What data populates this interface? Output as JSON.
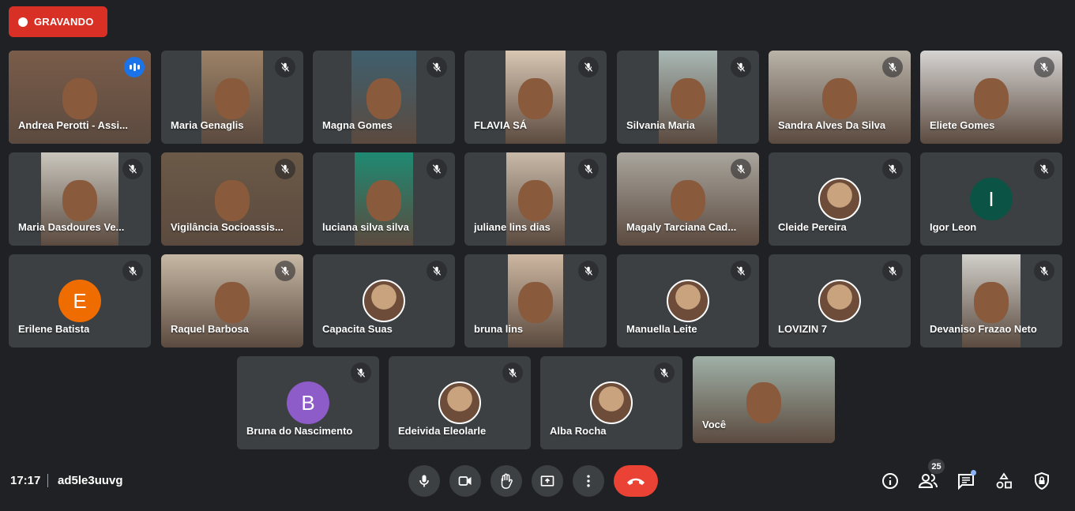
{
  "recording": {
    "label": "GRAVANDO"
  },
  "meeting": {
    "time": "17:17",
    "code": "ad5le3uuvg"
  },
  "participant_count": "25",
  "colors": {
    "background": "#202124",
    "tile": "#3c4043",
    "recording": "#d93025",
    "hangup": "#ea4335",
    "active_speaker": "#1a73e8"
  },
  "participants": [
    {
      "name": "Andrea Perotti - Assi...",
      "status": "speaking",
      "kind": "video"
    },
    {
      "name": "Maria Genaglis",
      "status": "muted",
      "kind": "video"
    },
    {
      "name": "Magna Gomes",
      "status": "muted",
      "kind": "video"
    },
    {
      "name": "FLAVIA SÁ",
      "status": "muted",
      "kind": "video"
    },
    {
      "name": "Silvania Maria",
      "status": "muted",
      "kind": "video"
    },
    {
      "name": "Sandra Alves Da Silva",
      "status": "muted",
      "kind": "video"
    },
    {
      "name": "Eliete Gomes",
      "status": "muted",
      "kind": "video"
    },
    {
      "name": "Maria Dasdoures Ve...",
      "status": "muted",
      "kind": "video"
    },
    {
      "name": "Vigilância Socioassis...",
      "status": "muted",
      "kind": "video"
    },
    {
      "name": "luciana silva silva",
      "status": "muted",
      "kind": "video"
    },
    {
      "name": "juliane lins dias",
      "status": "muted",
      "kind": "video"
    },
    {
      "name": "Magaly Tarciana Cad...",
      "status": "muted",
      "kind": "video"
    },
    {
      "name": "Cleide Pereira",
      "status": "muted",
      "kind": "photo-avatar"
    },
    {
      "name": "Igor Leon",
      "status": "muted",
      "kind": "letter-avatar",
      "initial": "I",
      "avatar_color": "#0b5345"
    },
    {
      "name": "Erilene Batista",
      "status": "muted",
      "kind": "letter-avatar",
      "initial": "E",
      "avatar_color": "#ef6c00"
    },
    {
      "name": "Raquel Barbosa",
      "status": "muted",
      "kind": "video"
    },
    {
      "name": "Capacita Suas",
      "status": "muted",
      "kind": "photo-avatar"
    },
    {
      "name": "bruna lins",
      "status": "muted",
      "kind": "video"
    },
    {
      "name": "Manuella Leite",
      "status": "muted",
      "kind": "photo-avatar"
    },
    {
      "name": "LOVIZIN 7",
      "status": "muted",
      "kind": "photo-avatar"
    },
    {
      "name": "Devaniso Frazao Neto",
      "status": "muted",
      "kind": "video"
    },
    {
      "name": "Bruna do Nascimento",
      "status": "muted",
      "kind": "letter-avatar",
      "initial": "B",
      "avatar_color": "#8e5cc9"
    },
    {
      "name": "Edeivida Eleolarle",
      "status": "muted",
      "kind": "photo-avatar"
    },
    {
      "name": "Alba Rocha",
      "status": "muted",
      "kind": "photo-avatar"
    },
    {
      "name": "Você",
      "status": "self",
      "kind": "video"
    }
  ],
  "controls": [
    {
      "name": "microphone",
      "icon": "mic-icon"
    },
    {
      "name": "camera",
      "icon": "camera-icon"
    },
    {
      "name": "raise-hand",
      "icon": "hand-icon"
    },
    {
      "name": "present",
      "icon": "present-screen-icon"
    },
    {
      "name": "more-options",
      "icon": "more-vert-icon"
    },
    {
      "name": "leave-call",
      "icon": "hangup-icon"
    }
  ],
  "side_controls": [
    {
      "name": "meeting-details",
      "icon": "info-icon"
    },
    {
      "name": "people",
      "icon": "people-icon"
    },
    {
      "name": "chat",
      "icon": "chat-icon"
    },
    {
      "name": "activities",
      "icon": "shapes-icon"
    },
    {
      "name": "host-controls",
      "icon": "lock-shield-icon"
    }
  ]
}
